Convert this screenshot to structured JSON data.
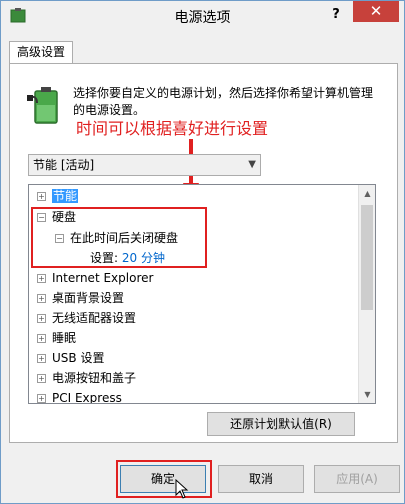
{
  "window": {
    "title": "电源选项",
    "help_glyph": "?",
    "close_glyph": "✕"
  },
  "tab": {
    "label": "高级设置"
  },
  "description": "选择你要自定义的电源计划，然后选择你希望计算机管理的电源设置。",
  "annotation": "时间可以根据喜好进行设置",
  "plan_select": {
    "value": "节能 [活动]"
  },
  "tree": {
    "items": [
      {
        "label": "节能",
        "expander": "+",
        "selected": true
      },
      {
        "label": "硬盘",
        "expander": "−"
      },
      {
        "label": "在此时间后关闭硬盘",
        "expander": "−"
      },
      {
        "label_prefix": "设置:",
        "value": "20 分钟"
      },
      {
        "label": "Internet Explorer",
        "expander": "+"
      },
      {
        "label": "桌面背景设置",
        "expander": "+"
      },
      {
        "label": "无线适配器设置",
        "expander": "+"
      },
      {
        "label": "睡眠",
        "expander": "+"
      },
      {
        "label": "USB 设置",
        "expander": "+"
      },
      {
        "label": "电源按钮和盖子",
        "expander": "+"
      },
      {
        "label": "PCI Express",
        "expander": "+"
      }
    ]
  },
  "buttons": {
    "restore": "还原计划默认值(R)",
    "ok": "确定",
    "cancel": "取消",
    "apply": "应用(A)"
  },
  "colors": {
    "annotation": "#e02020",
    "close": "#c7413b",
    "link": "#0066cc",
    "selection": "#3399ff"
  }
}
